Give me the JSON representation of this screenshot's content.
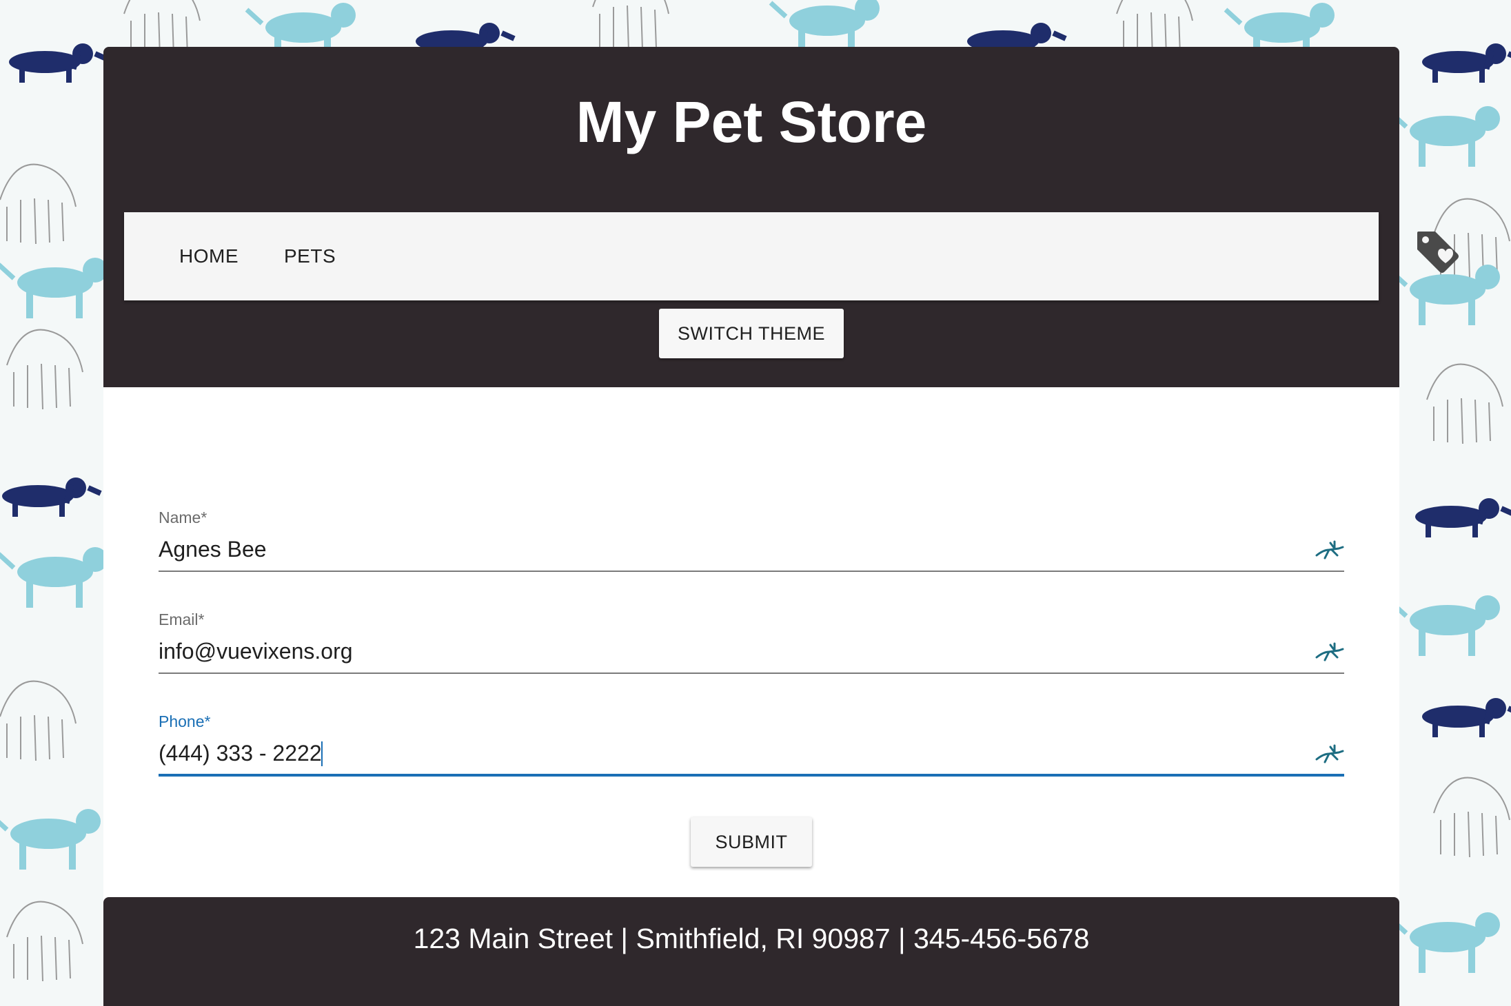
{
  "header": {
    "title": "My Pet Store"
  },
  "nav": {
    "items": [
      {
        "label": "HOME"
      },
      {
        "label": "PETS"
      }
    ],
    "wishlist_icon": "tag-heart-icon"
  },
  "theme_button": {
    "label": "SWITCH THEME"
  },
  "form": {
    "fields": [
      {
        "label": "Name*",
        "value": "Agnes Bee",
        "icon": "gazelle-icon",
        "active": false
      },
      {
        "label": "Email*",
        "value": "info@vuevixens.org",
        "icon": "gazelle-icon",
        "active": false
      },
      {
        "label": "Phone*",
        "value": "(444) 333 - 2222",
        "icon": "gazelle-icon",
        "active": true
      }
    ],
    "submit_label": "SUBMIT"
  },
  "footer": {
    "text": "123 Main Street | Smithfield, RI 90987 | 345-456-5678"
  },
  "colors": {
    "header_bg": "#2f282c",
    "nav_bg": "#f5f5f5",
    "accent": "#1a6fb5",
    "icon": "#1d6d82",
    "pattern_light_dog": "#8fd0dc",
    "pattern_dark_dog": "#1f2d6b"
  }
}
